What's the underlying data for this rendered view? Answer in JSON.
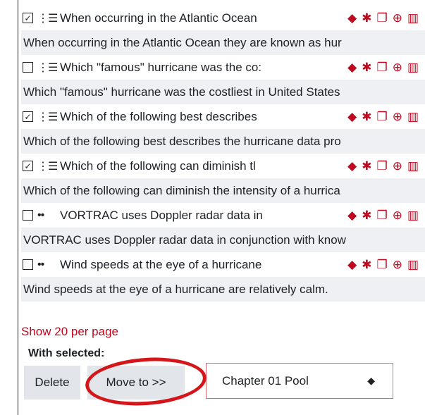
{
  "questions": [
    {
      "checked": true,
      "type_glyph": "⋮☰",
      "name": "When occurring in the Atlantic Ocean",
      "full_text": "When occurring in the Atlantic Ocean they are known as hur"
    },
    {
      "checked": false,
      "type_glyph": "⋮☰",
      "name": "Which \"famous\" hurricane was the co:",
      "full_text": "Which \"famous\" hurricane was the costliest in United States"
    },
    {
      "checked": true,
      "type_glyph": "⋮☰",
      "name": "Which of the following best describes",
      "full_text": "Which of the following best describes the hurricane data pro"
    },
    {
      "checked": true,
      "type_glyph": "⋮☰",
      "name": "Which of the following can diminish tl",
      "full_text": "Which of the following can diminish the intensity of a hurrica"
    },
    {
      "checked": false,
      "type_glyph": "••",
      "name": "VORTRAC uses Doppler radar data in",
      "full_text": "VORTRAC uses Doppler radar data in conjunction with know"
    },
    {
      "checked": false,
      "type_glyph": "••",
      "name": "Wind speeds at the eye of a hurricane",
      "full_text": "Wind speeds at the eye of a hurricane are relatively calm."
    }
  ],
  "action_icons": [
    "tag-icon",
    "gear-icon",
    "copy-icon",
    "zoom-icon",
    "trash-icon"
  ],
  "show_per_page": "Show 20 per page",
  "with_selected_label": "With selected:",
  "buttons": {
    "delete": "Delete",
    "move": "Move to >>"
  },
  "category_select": {
    "value": "Chapter 01 Pool"
  },
  "colors": {
    "accent": "#c0081f",
    "highlight": "#d4161b",
    "row_alt": "#eef0f3"
  }
}
